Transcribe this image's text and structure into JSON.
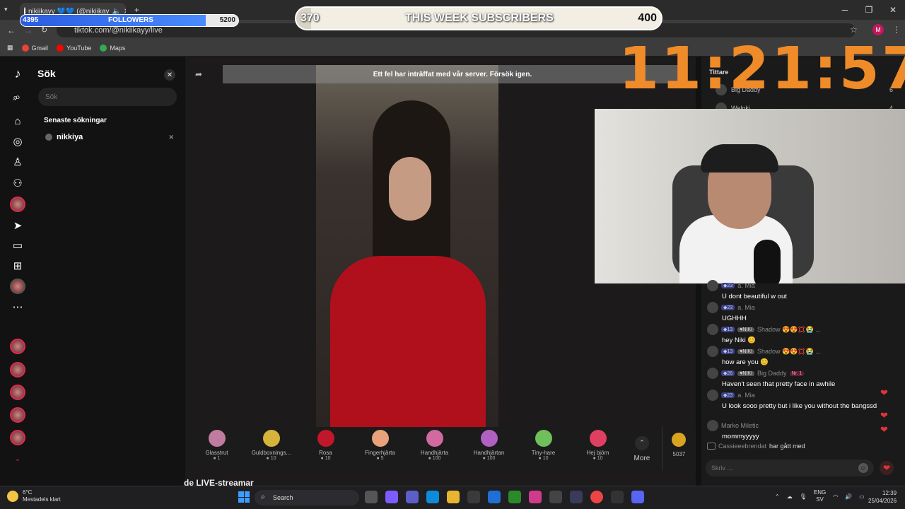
{
  "browser": {
    "tab_title": "nikiikayy 💙💙 (@nikiikay",
    "url": "tiktok.com/@nikiikayy/live",
    "bookmarks": [
      "Gmail",
      "YouTube",
      "Maps"
    ],
    "profile_initial": "M"
  },
  "overlay": {
    "followers_left": "4395",
    "followers_label": "FOLLOWERS",
    "followers_right": "5200",
    "followers_progress": 0.85,
    "subs_left": "370",
    "subs_label": "THIS WEEK SUBSCRIBERS",
    "subs_right": "400",
    "subs_progress": 0.04,
    "timer": "11:21:57"
  },
  "search": {
    "title": "Sök",
    "placeholder": "Sök",
    "recent_heading": "Senaste sökningar",
    "recent_item": "nikkiya"
  },
  "video": {
    "error_message": "Ett fel har inträffat med vår server. Försök igen."
  },
  "gifts": [
    {
      "name": "Glasstrut",
      "price": "1",
      "color": "#c27ba0"
    },
    {
      "name": "Guldboxnings...",
      "price": "10",
      "color": "#d6b43a"
    },
    {
      "name": "Rosa",
      "price": "10",
      "color": "#c0182a"
    },
    {
      "name": "Fingerhjärta",
      "price": "5",
      "color": "#e8a27c"
    },
    {
      "name": "Handhjärta",
      "price": "100",
      "color": "#d06aa0"
    },
    {
      "name": "Handhjärtan",
      "price": "100",
      "color": "#b060c0"
    },
    {
      "name": "Tiny-hare",
      "price": "10",
      "color": "#6fbf5a"
    },
    {
      "name": "Hej björn",
      "price": "10",
      "color": "#e04060"
    }
  ],
  "gift_more": "More",
  "coins": "5037",
  "streamers_heading": "de LIVE-streamar",
  "viewers": {
    "heading": "Tittare",
    "rows": [
      {
        "name": "Big Daddy",
        "count": "6"
      },
      {
        "name": "Weloki",
        "count": "4"
      }
    ]
  },
  "chat": [
    {
      "level": "23",
      "user": "a. Mia",
      "text": "U dont beautiful w out"
    },
    {
      "level": "23",
      "user": "a. Mia",
      "text": "UGHHH"
    },
    {
      "level": "13",
      "fan": "NIKI",
      "user": "Shadow 😍😍💢😭 ...",
      "text": "hey Niki 😊"
    },
    {
      "level": "13",
      "fan": "NIKI",
      "user": "Shadow 😍😍💢😭 ...",
      "text": "how are you 😊"
    },
    {
      "level": "26",
      "fan": "NIKI",
      "user": "Big Daddy",
      "rank": "Nr. 1",
      "text": "Haven't seen that pretty face in awhile"
    },
    {
      "level": "23",
      "user": "a. Mia",
      "text": "U look sooo pretty but i like you without the bangssd"
    },
    {
      "user": "Marko Miletic",
      "text": "mommyyyyy"
    }
  ],
  "chat_join": {
    "user": "Cassieeebrendat",
    "text": "har gått med"
  },
  "chat_placeholder": "Skriv ...",
  "taskbar": {
    "temp": "6°C",
    "weather": "Mestadels klart",
    "search": "Search",
    "lang1": "ENG",
    "lang2": "SV",
    "time": "12:39",
    "date": "25/04/2026"
  }
}
